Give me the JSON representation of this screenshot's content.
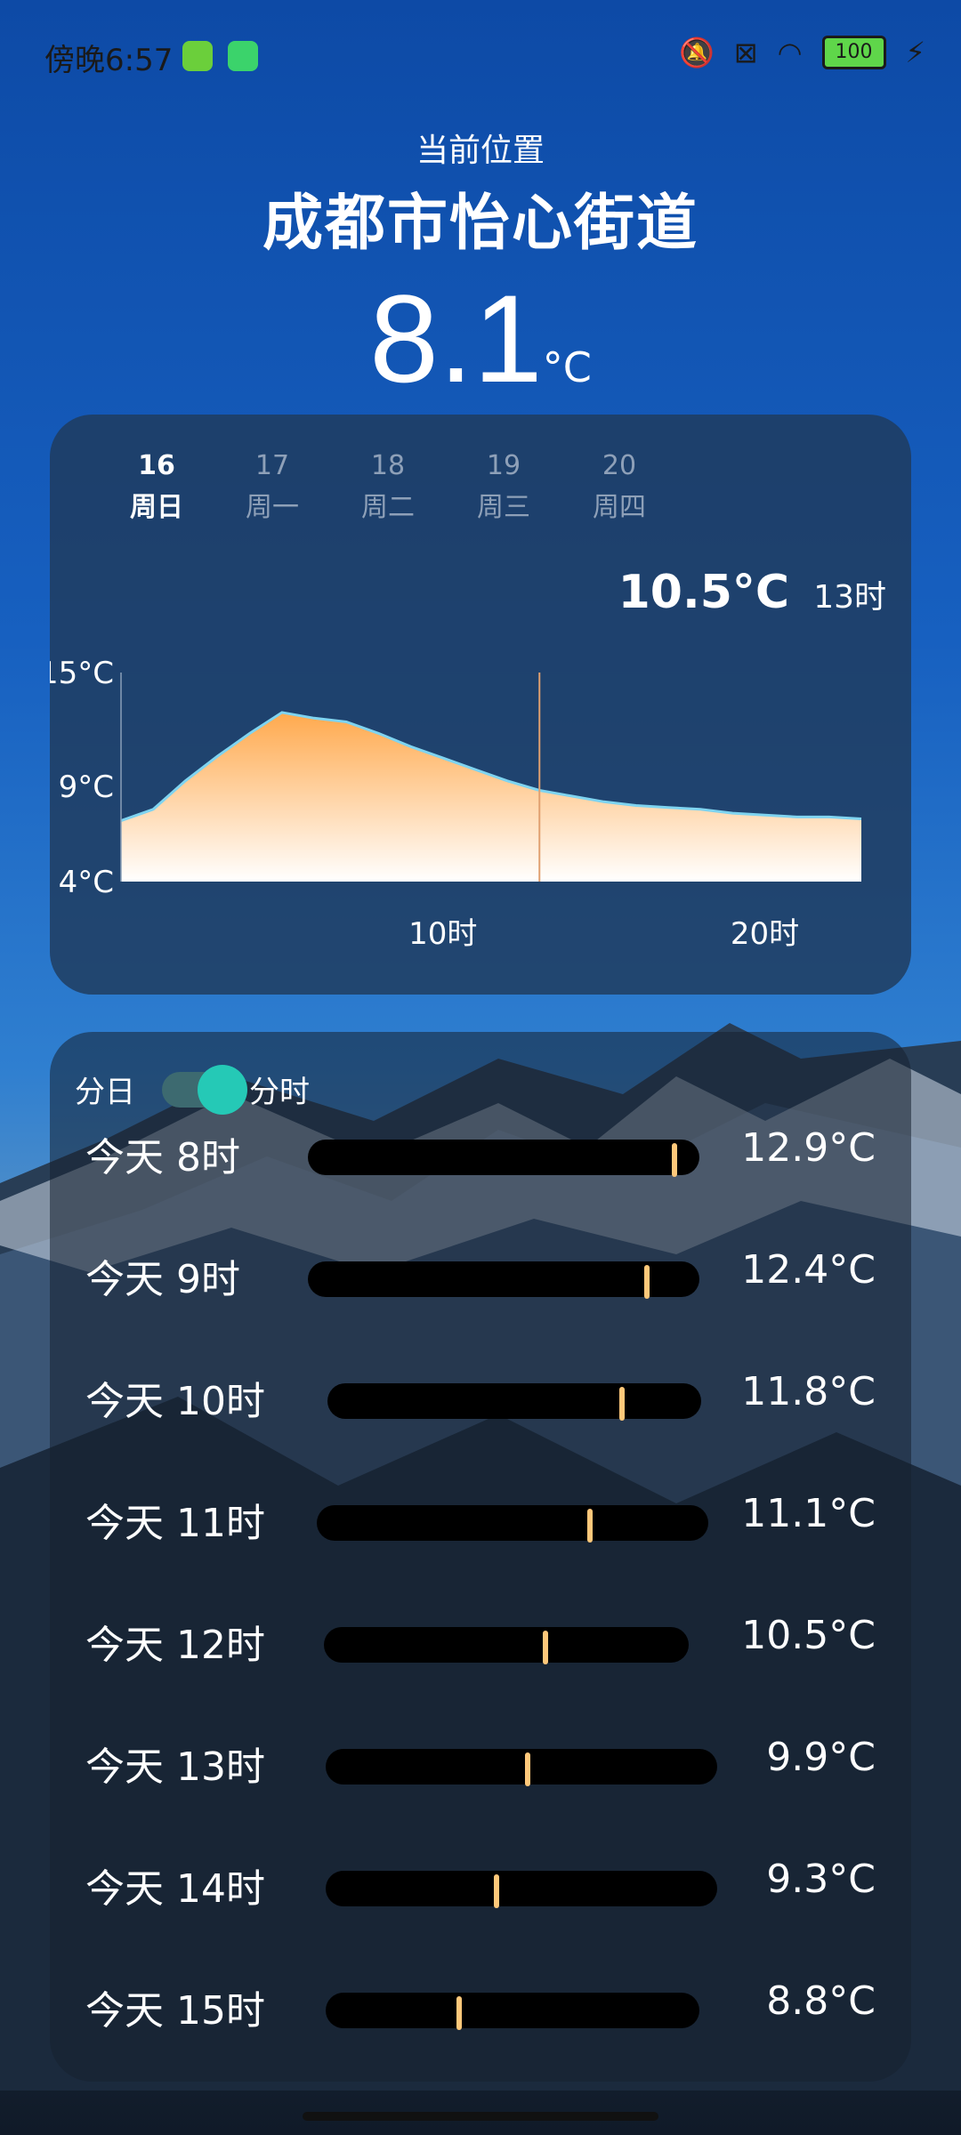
{
  "status_bar": {
    "time": "傍晚6:57",
    "battery": "100"
  },
  "location": {
    "label": "当前位置",
    "name": "成都市怡心街道"
  },
  "current": {
    "temp": "8.1",
    "unit": "°C"
  },
  "days": [
    {
      "num": "16",
      "weekday": "周日",
      "active": true
    },
    {
      "num": "17",
      "weekday": "周一",
      "active": false
    },
    {
      "num": "18",
      "weekday": "周二",
      "active": false
    },
    {
      "num": "19",
      "weekday": "周三",
      "active": false
    },
    {
      "num": "20",
      "weekday": "周四",
      "active": false
    }
  ],
  "selected": {
    "temp": "10.5°C",
    "hour": "13时"
  },
  "chart_data": {
    "type": "area",
    "y_ticks": [
      "15°C",
      "9°C",
      "4°C"
    ],
    "x_ticks": [
      "10时",
      "20时"
    ],
    "ylim": [
      4,
      15
    ],
    "xlim": [
      0,
      23
    ],
    "x": [
      0,
      1,
      2,
      3,
      4,
      5,
      6,
      7,
      8,
      9,
      10,
      11,
      12,
      13,
      14,
      15,
      16,
      17,
      18,
      19,
      20,
      21,
      22,
      23
    ],
    "values": [
      7.2,
      7.8,
      9.3,
      10.6,
      11.8,
      12.9,
      12.6,
      12.4,
      11.8,
      11.1,
      10.5,
      9.9,
      9.3,
      8.8,
      8.5,
      8.2,
      8.0,
      7.9,
      7.8,
      7.6,
      7.5,
      7.4,
      7.4,
      7.3
    ],
    "selected_x": 13,
    "colors": {
      "fill_top": "#ffa94d",
      "fill_bottom": "#ffffff",
      "line": "#7fd4f0",
      "marker": "#e0a070"
    }
  },
  "toggle": {
    "left": "分日",
    "right": "分时"
  },
  "hourly": [
    {
      "label": "今天  8时",
      "value": "12.9°C",
      "pos": 0.93
    },
    {
      "label": "今天  9时",
      "value": "12.4°C",
      "pos": 0.86
    },
    {
      "label": "今天  10时",
      "value": "11.8°C",
      "pos": 0.78
    },
    {
      "label": "今天  11时",
      "value": "11.1°C",
      "pos": 0.69
    },
    {
      "label": "今天  12时",
      "value": "10.5°C",
      "pos": 0.6
    },
    {
      "label": "今天  13时",
      "value": "9.9°C",
      "pos": 0.51
    },
    {
      "label": "今天  14时",
      "value": "9.3°C",
      "pos": 0.43
    },
    {
      "label": "今天  15时",
      "value": "8.8°C",
      "pos": 0.35
    }
  ]
}
